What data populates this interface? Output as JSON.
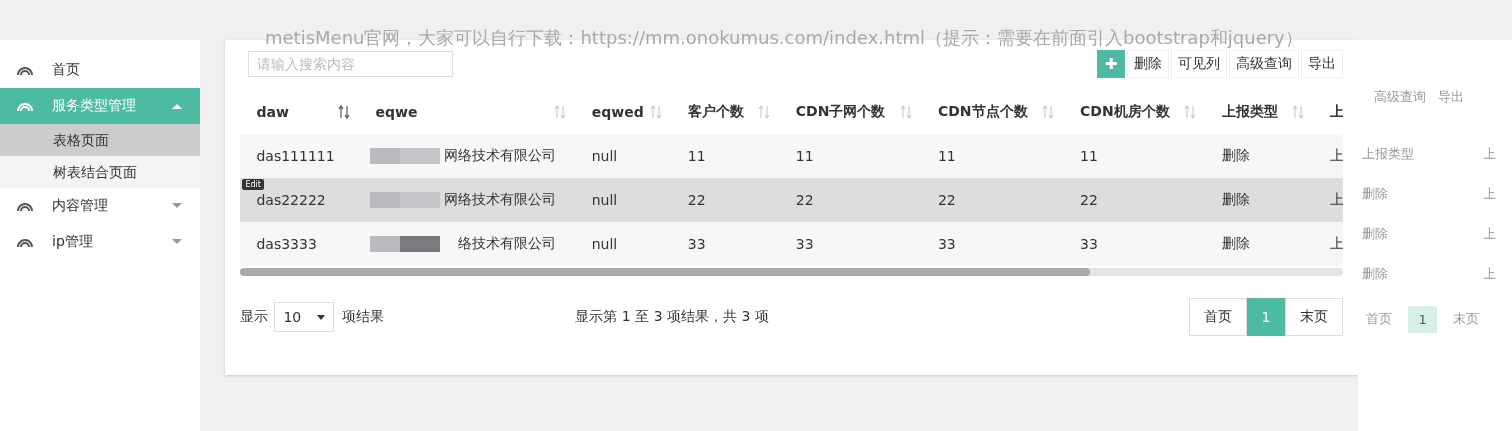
{
  "note": "metisMenu官网，大家可以自行下载：https://mm.onokumus.com/index.html（提示：需要在前面引入bootstrap和jquery）",
  "sidebar": {
    "items": [
      {
        "label": "首页",
        "selected": false
      },
      {
        "label": "服务类型管理",
        "selected": true,
        "expanded": true,
        "children": [
          {
            "label": "表格页面",
            "selected": true
          },
          {
            "label": "树表结合页面",
            "selected": false
          }
        ]
      },
      {
        "label": "内容管理",
        "selected": false,
        "expanded": false
      },
      {
        "label": "ip管理",
        "selected": false,
        "expanded": false
      }
    ]
  },
  "search": {
    "placeholder": "请输入搜索内容"
  },
  "toolbar": {
    "add": "✚",
    "buttons": [
      "删除",
      "可见列",
      "高级查询",
      "导出"
    ]
  },
  "table": {
    "columns": [
      "daw",
      "eqwe",
      "eqwed",
      "客户个数",
      "CDN子网个数",
      "CDN节点个数",
      "CDN机房个数",
      "上报类型",
      "上"
    ],
    "rows": [
      {
        "selected": false,
        "badge": "",
        "cells": [
          "das111111",
          "网络技术有限公司",
          "null",
          "11",
          "11",
          "11",
          "11",
          "删除",
          "上"
        ]
      },
      {
        "selected": true,
        "badge": "Edit",
        "cells": [
          "das22222",
          "网络技术有限公司",
          "null",
          "22",
          "22",
          "22",
          "22",
          "删除",
          "上"
        ]
      },
      {
        "selected": false,
        "badge": "",
        "cells": [
          "das3333",
          "络技术有限公司",
          "null",
          "33",
          "33",
          "33",
          "33",
          "删除",
          "上"
        ]
      }
    ]
  },
  "footer": {
    "show": "显示",
    "page_size": "10",
    "suffix": "项结果",
    "summary": "显示第 1 至 3 项结果，共 3 项",
    "pages": [
      {
        "label": "首页",
        "selected": false
      },
      {
        "label": "1",
        "selected": true
      },
      {
        "label": "末页",
        "selected": false
      }
    ]
  },
  "ghost": {
    "buttons": [
      "高级查询",
      "导出"
    ],
    "header": [
      "上报类型",
      "上"
    ],
    "rows": [
      [
        "删除",
        "上"
      ],
      [
        "删除",
        "上"
      ],
      [
        "删除",
        "上"
      ]
    ],
    "pages": [
      "首页",
      "1",
      "末页"
    ]
  }
}
